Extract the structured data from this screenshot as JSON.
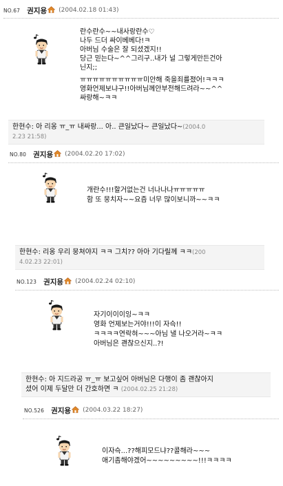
{
  "posts": [
    {
      "no": "NO.67",
      "author": "권지용",
      "date": "(2004.02.18 01:43)",
      "lines": [
        "란수란수~~내사랑란수♡",
        "나두 드더 싸이베베다!ㅋ",
        "아버님 수술은 잘 되셨겠지!!",
        "당근 믿는다~^^그리구..내가 널 그렇게만든건아",
        "닌지;;",
        "ㅠㅠㅠㅠㅠㅠㅠㅠㅠㅠ미안해  죽을죄를졌어!ㅋㅋㅋ",
        "영화언제보냐구!!아버님께안부전해드려라~~^^",
        "싸랑해~ㅋㅋ"
      ],
      "reply": {
        "text1": "한현수: 아 리옹 ㅠ_ㅠ 내싸랑... 아.. 큰일났다~ 큰일났다~",
        "date1": "(2004.0",
        "date2": "2.23 21:58)"
      }
    },
    {
      "no": "NO.80",
      "author": "권지용",
      "date": "(2004.02.20 17:02)",
      "lines": [
        "개란수!!!할거없는건 너나나나ㅠㅠㅠㅠㅠ",
        "함 또 뭉치자~~요즘 너무 많이보니까~~ㅋㅋ"
      ],
      "reply": {
        "text1": "한현수: 리옹 우리 뭉쳐야지 ㅋㅋ 그치?? 아아 기다릴께 ㅋㅋ",
        "date1": "(200",
        "date2": "4.02.23 22:01)"
      }
    },
    {
      "no": "NO.123",
      "author": "권지용",
      "date": "(2004.02.24 02:10)",
      "lines": [
        "자기이이이잉~ㅋㅋ",
        "영화 언제보는거야!!!이 자슥!!",
        "ㅋㅋㅋㅋ연락혀~~~아님 낼 나오거라~ㅋㅋ",
        "아버님은 괜찮으신지..?!"
      ],
      "reply": {
        "text1": "한현수: 아 지드라공 ㅠ_ㅠ 보고싶어 아버님은 다행이 좀 괜찮아지",
        "text2": "셨어 이제 두달만 더 간호하면 ㅋ",
        "date2": "(2004.02.25 21:28)"
      }
    },
    {
      "no": "NO.526",
      "author": "권지용",
      "date": "(2004.03.22 18:27)",
      "lines": [
        "이자슥...??해피모드냐??콜해라~~~",
        "애기좀해야겠어~~~~~~~~~!!!ㅋㅋㅋㅋ"
      ]
    }
  ]
}
